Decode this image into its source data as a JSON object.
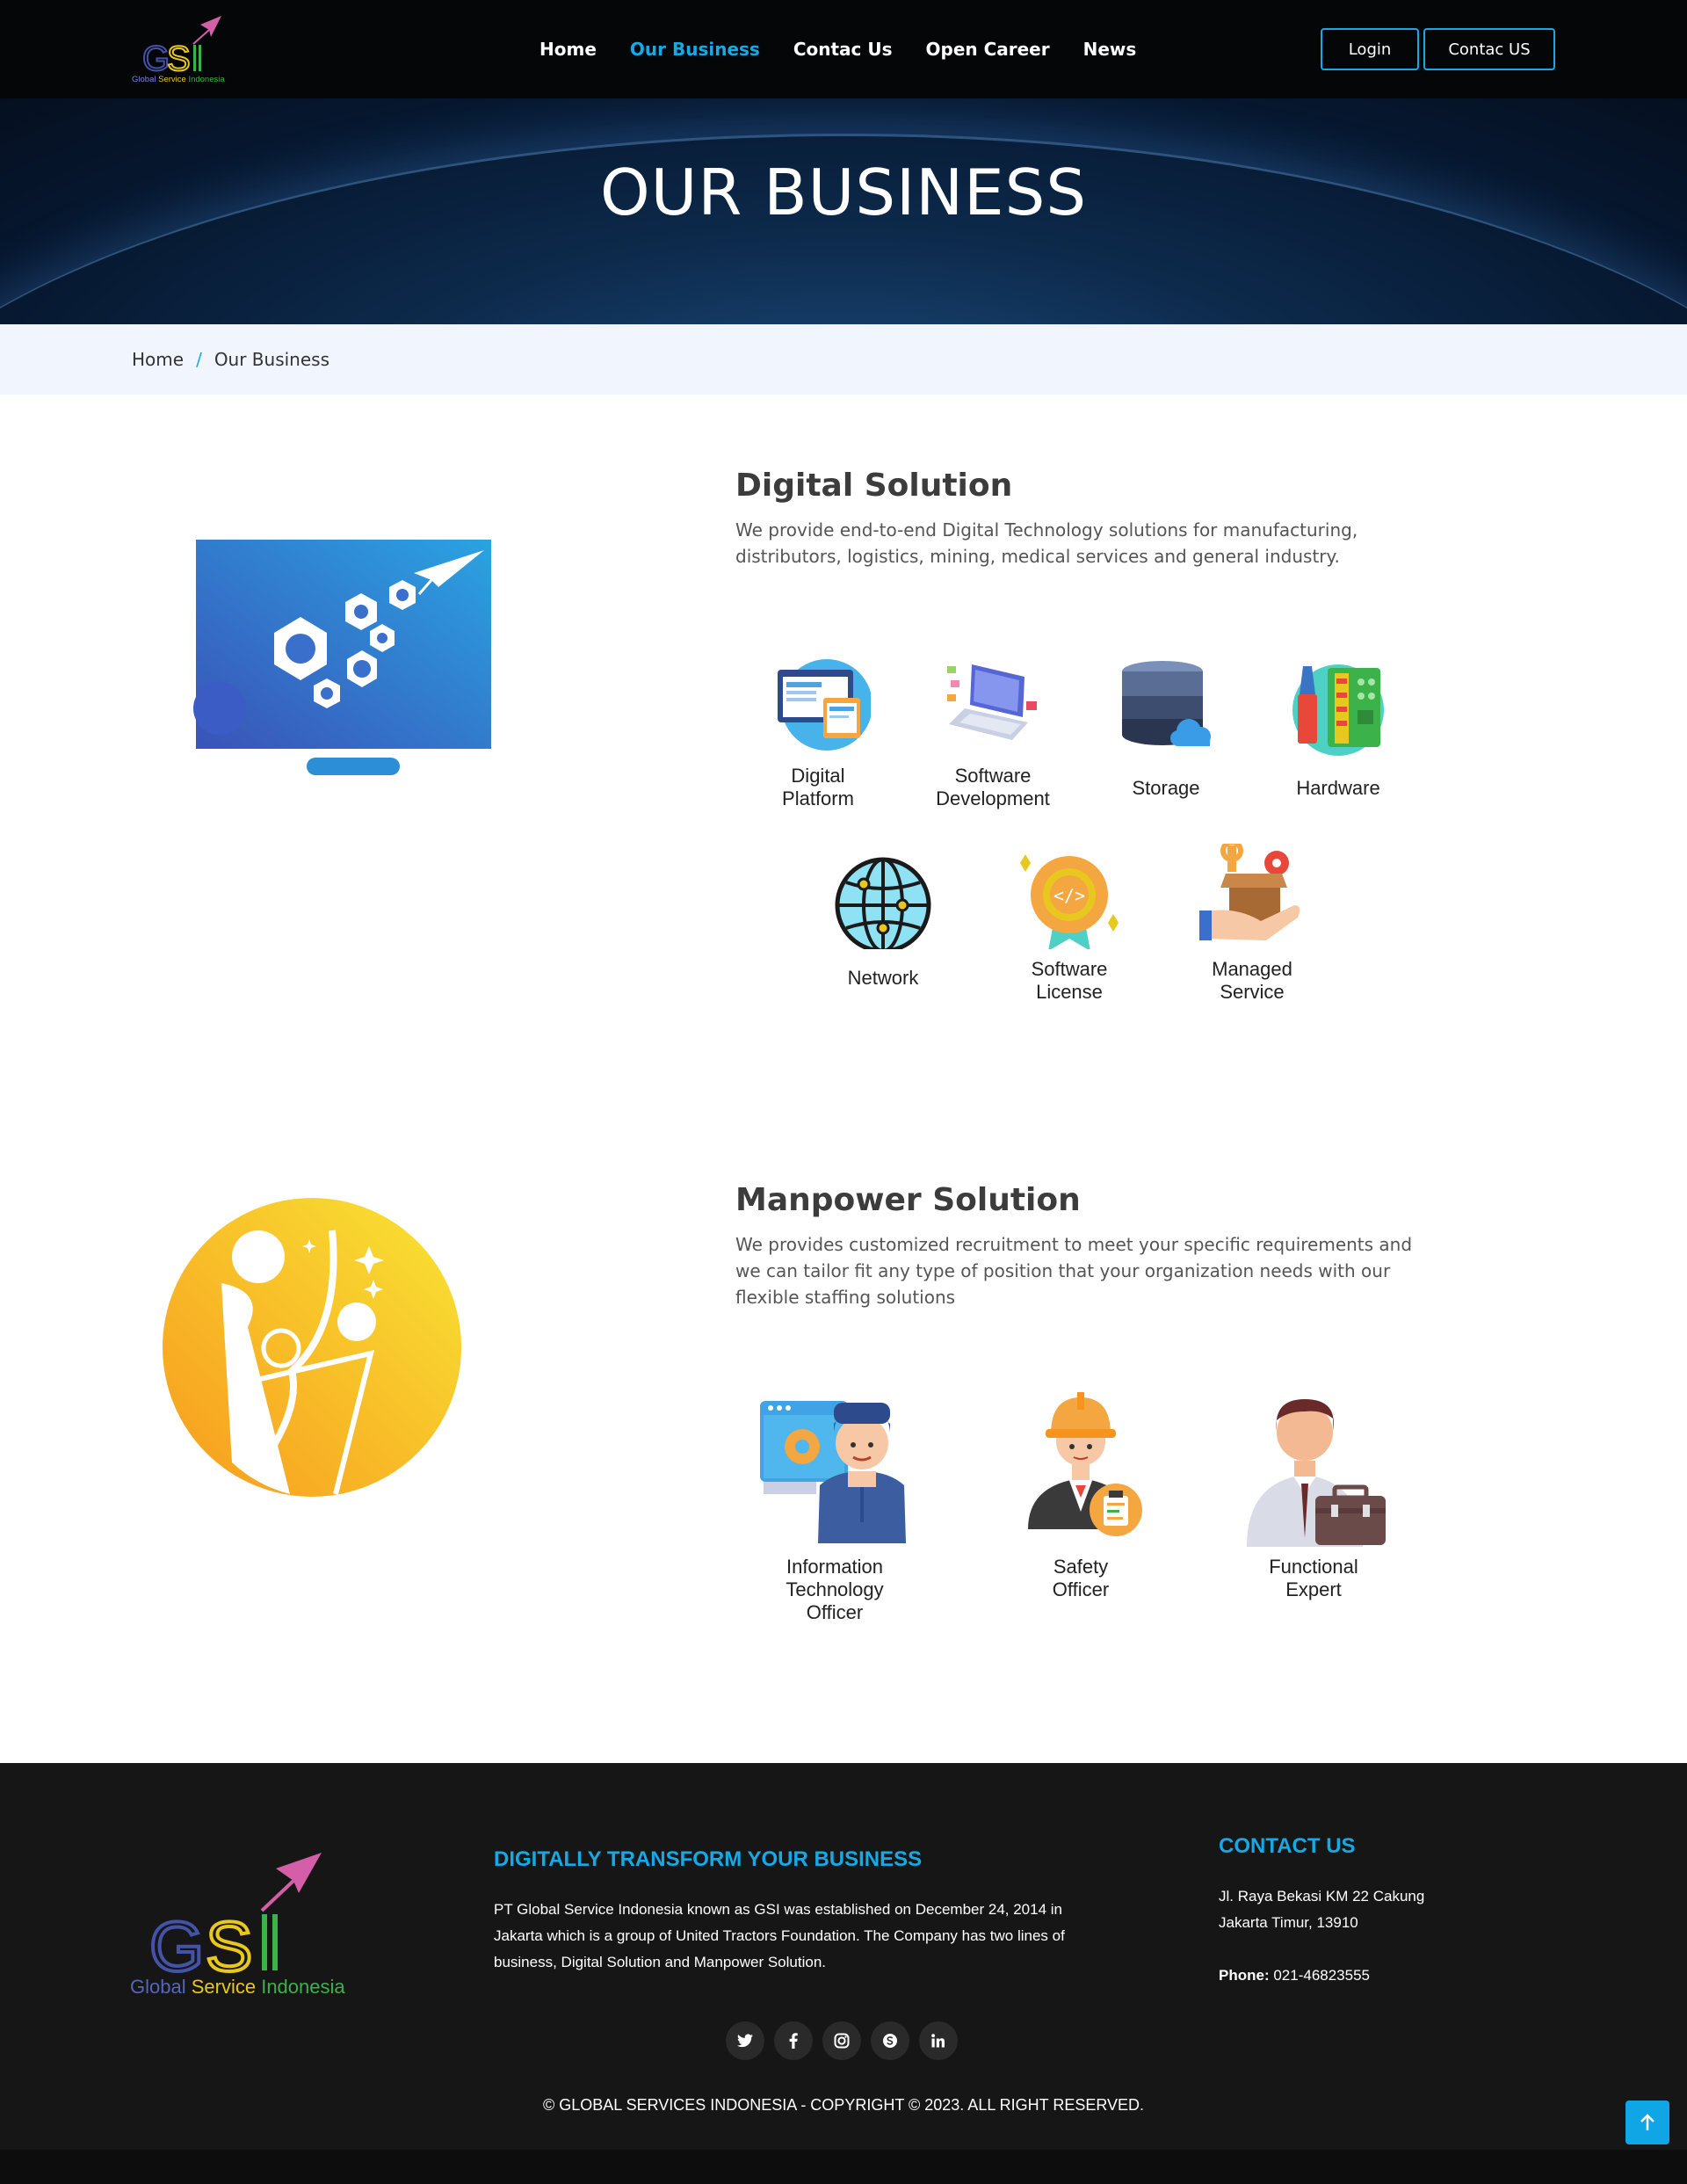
{
  "header": {
    "logo_text": "GSI",
    "logo_subtitle": "Global Service Indonesia",
    "nav": [
      {
        "label": "Home"
      },
      {
        "label": "Our Business"
      },
      {
        "label": "Contac Us"
      },
      {
        "label": "Open Career"
      },
      {
        "label": "News"
      }
    ],
    "login_label": "Login",
    "contact_label": "Contac US"
  },
  "hero": {
    "title": "OUR BUSINESS"
  },
  "breadcrumb": {
    "home": "Home",
    "separator": "/",
    "current": "Our Business"
  },
  "digital": {
    "title": "Digital Solution",
    "desc": "We provide end-to-end Digital Technology solutions for manufacturing, distributors, logistics, mining, medical services and general industry.",
    "items": [
      {
        "label": "Digital\nPlatform",
        "icon": "web-platform-icon"
      },
      {
        "label": "Software\nDevelopment",
        "icon": "laptop-code-icon"
      },
      {
        "label": "Storage",
        "icon": "database-cloud-icon"
      },
      {
        "label": "Hardware",
        "icon": "circuit-board-icon"
      },
      {
        "label": "Network",
        "icon": "globe-network-icon"
      },
      {
        "label": "Software\nLicense",
        "icon": "badge-code-icon"
      },
      {
        "label": "Managed\nService",
        "icon": "hand-box-icon"
      }
    ]
  },
  "manpower": {
    "title": "Manpower Solution",
    "desc": "We provides customized recruitment to meet your specific requirements and we can tailor fit any type of position that your organization needs with our flexible staffing solutions",
    "items": [
      {
        "label": "Information\nTechnology\nOfficer",
        "icon": "it-officer-icon"
      },
      {
        "label": "Safety\nOfficer",
        "icon": "safety-officer-icon"
      },
      {
        "label": "Functional\nExpert",
        "icon": "business-expert-icon"
      }
    ]
  },
  "footer": {
    "logo_subtitle_1": "Global",
    "logo_subtitle_2": "Service",
    "logo_subtitle_3": "Indonesia",
    "about_title": "DIGITALLY TRANSFORM YOUR BUSINESS",
    "about_text": "PT Global Service Indonesia known as GSI was established on December 24, 2014 in Jakarta which is a group of United Tractors Foundation. The Company has two lines of business, Digital Solution and Manpower Solution.",
    "contact_title": "CONTACT US",
    "address_1": "Jl. Raya Bekasi KM 22 Cakung",
    "address_2": "Jakarta Timur, 13910",
    "phone_label": "Phone:",
    "phone": "021-46823555",
    "social": [
      "twitter-icon",
      "facebook-icon",
      "instagram-icon",
      "skype-icon",
      "linkedin-icon"
    ],
    "copyright": "© GLOBAL SERVICES INDONESIA - COPYRIGHT © 2023. ALL RIGHT RESERVED."
  },
  "colors": {
    "accent": "#17a9e6",
    "dark": "#040608",
    "footer": "#161616"
  }
}
